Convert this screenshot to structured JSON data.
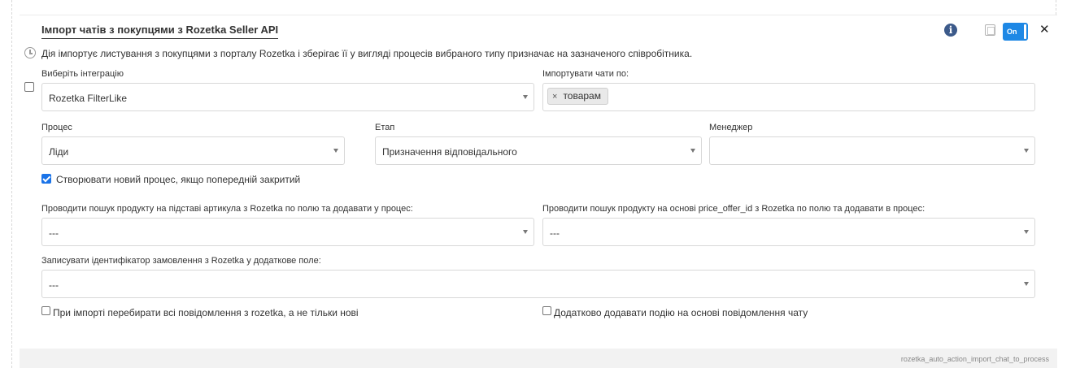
{
  "title": "Імпорт чатів з покупцями з Rozetka Seller API",
  "description": "Дія імпортує листування з покупцями з порталу Rozetka і зберігає її у вигляді процесів вибраного типу призначає на зазначеного співробітника.",
  "toggle": {
    "label": "On",
    "state": "on",
    "color": "#1e88e5"
  },
  "icons": {
    "info": "info-icon",
    "copy": "copy-icon",
    "close": "close-icon",
    "clock": "clock-icon"
  },
  "info_glyph": "i",
  "close_glyph": "✕",
  "integration": {
    "label": "Виберіть інтеграцію",
    "value": "Rozetka FilterLike"
  },
  "import_by": {
    "label": "Імпортувати чати по:",
    "tag_remove": "×",
    "tags": [
      "товарам"
    ]
  },
  "process": {
    "label": "Процес",
    "value": "Ліди"
  },
  "stage": {
    "label": "Етап",
    "value": "Призначення відповідального"
  },
  "manager": {
    "label": "Менеджер",
    "value": ""
  },
  "create_new": {
    "label": "Створювати новий процес, якщо попередній закритий",
    "checked": true
  },
  "search_by_article": {
    "label": "Проводити пошук продукту на підставі артикула з Rozetka по полю та додавати у процес:",
    "value": "---"
  },
  "search_by_offer": {
    "label": "Проводити пошук продукту на основі price_offer_id з Rozetka по полю та додавати в процес:",
    "value": "---"
  },
  "order_id_field": {
    "label": "Записувати ідентифікатор замовлення з Rozetka у додаткове поле:",
    "value": "---"
  },
  "iterate_all": {
    "label": "При імпорті перебирати всі повідомлення з rozetka, а не тільки нові",
    "checked": false
  },
  "add_event": {
    "label": "Додатково додавати подію на основі повідомлення чату",
    "checked": false
  },
  "footer_code": "rozetka_auto_action_import_chat_to_process"
}
